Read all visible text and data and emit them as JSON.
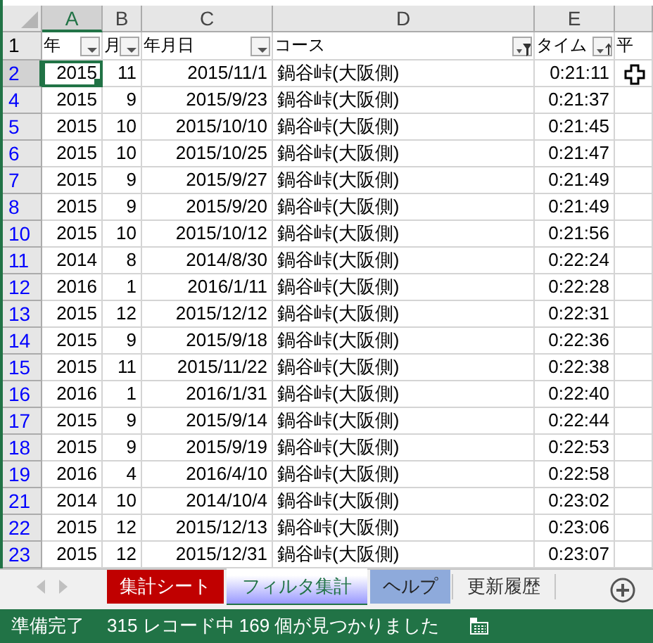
{
  "columns": [
    {
      "letter": "A",
      "header": "年",
      "selected": true,
      "kind": "dropdown"
    },
    {
      "letter": "B",
      "header": "月",
      "selected": false,
      "kind": "dropdown"
    },
    {
      "letter": "C",
      "header": "年月日",
      "selected": false,
      "kind": "dropdown"
    },
    {
      "letter": "D",
      "header": "コース",
      "selected": false,
      "kind": "filtered"
    },
    {
      "letter": "E",
      "header": "タイム",
      "selected": false,
      "kind": "sorted"
    },
    {
      "header": "平",
      "kind": "plain"
    }
  ],
  "header_row_number": "1",
  "rows": [
    {
      "number": "2",
      "selected": true,
      "filtered": true,
      "cells": [
        "2015",
        "11",
        "2015/11/1",
        "鍋谷峠(大阪側)",
        "0:21:11"
      ]
    },
    {
      "number": "4",
      "selected": false,
      "filtered": true,
      "cells": [
        "2015",
        "9",
        "2015/9/23",
        "鍋谷峠(大阪側)",
        "0:21:37"
      ]
    },
    {
      "number": "5",
      "selected": false,
      "filtered": true,
      "cells": [
        "2015",
        "10",
        "2015/10/10",
        "鍋谷峠(大阪側)",
        "0:21:45"
      ]
    },
    {
      "number": "6",
      "selected": false,
      "filtered": true,
      "cells": [
        "2015",
        "10",
        "2015/10/25",
        "鍋谷峠(大阪側)",
        "0:21:47"
      ]
    },
    {
      "number": "7",
      "selected": false,
      "filtered": true,
      "cells": [
        "2015",
        "9",
        "2015/9/27",
        "鍋谷峠(大阪側)",
        "0:21:49"
      ]
    },
    {
      "number": "8",
      "selected": false,
      "filtered": true,
      "cells": [
        "2015",
        "9",
        "2015/9/20",
        "鍋谷峠(大阪側)",
        "0:21:49"
      ]
    },
    {
      "number": "10",
      "selected": false,
      "filtered": true,
      "cells": [
        "2015",
        "10",
        "2015/10/12",
        "鍋谷峠(大阪側)",
        "0:21:56"
      ]
    },
    {
      "number": "11",
      "selected": false,
      "filtered": true,
      "cells": [
        "2014",
        "8",
        "2014/8/30",
        "鍋谷峠(大阪側)",
        "0:22:24"
      ]
    },
    {
      "number": "12",
      "selected": false,
      "filtered": true,
      "cells": [
        "2016",
        "1",
        "2016/1/11",
        "鍋谷峠(大阪側)",
        "0:22:28"
      ]
    },
    {
      "number": "13",
      "selected": false,
      "filtered": true,
      "cells": [
        "2015",
        "12",
        "2015/12/12",
        "鍋谷峠(大阪側)",
        "0:22:31"
      ]
    },
    {
      "number": "14",
      "selected": false,
      "filtered": true,
      "cells": [
        "2015",
        "9",
        "2015/9/18",
        "鍋谷峠(大阪側)",
        "0:22:36"
      ]
    },
    {
      "number": "15",
      "selected": false,
      "filtered": true,
      "cells": [
        "2015",
        "11",
        "2015/11/22",
        "鍋谷峠(大阪側)",
        "0:22:38"
      ]
    },
    {
      "number": "16",
      "selected": false,
      "filtered": true,
      "cells": [
        "2016",
        "1",
        "2016/1/31",
        "鍋谷峠(大阪側)",
        "0:22:40"
      ]
    },
    {
      "number": "17",
      "selected": false,
      "filtered": true,
      "cells": [
        "2015",
        "9",
        "2015/9/14",
        "鍋谷峠(大阪側)",
        "0:22:44"
      ]
    },
    {
      "number": "18",
      "selected": false,
      "filtered": true,
      "cells": [
        "2015",
        "9",
        "2015/9/19",
        "鍋谷峠(大阪側)",
        "0:22:53"
      ]
    },
    {
      "number": "19",
      "selected": false,
      "filtered": true,
      "cells": [
        "2016",
        "4",
        "2016/4/10",
        "鍋谷峠(大阪側)",
        "0:22:58"
      ]
    },
    {
      "number": "21",
      "selected": false,
      "filtered": true,
      "cells": [
        "2014",
        "10",
        "2014/10/4",
        "鍋谷峠(大阪側)",
        "0:23:02"
      ]
    },
    {
      "number": "22",
      "selected": false,
      "filtered": true,
      "cells": [
        "2015",
        "12",
        "2015/12/13",
        "鍋谷峠(大阪側)",
        "0:23:06"
      ]
    },
    {
      "number": "23",
      "selected": false,
      "filtered": true,
      "cells": [
        "2015",
        "12",
        "2015/12/31",
        "鍋谷峠(大阪側)",
        "0:23:07"
      ]
    }
  ],
  "sheet_tabs": [
    {
      "label": "集計シート",
      "selected": false,
      "color": "#c00000"
    },
    {
      "label": "フィルタ集計",
      "selected": true,
      "color": "#9999ff"
    },
    {
      "label": "ヘルプ",
      "selected": false,
      "color": "#8eaadb"
    },
    {
      "label": "更新履歴",
      "selected": false
    }
  ],
  "status_bar": {
    "state": "準備完了",
    "message": "315 レコード中 169 個が見つかりました"
  }
}
